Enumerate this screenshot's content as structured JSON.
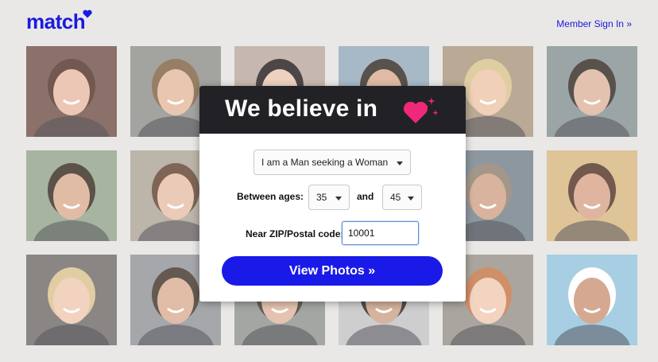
{
  "header": {
    "logo_text": "match",
    "sign_in_link": "Member Sign In »"
  },
  "photos": [
    {
      "name": "photo-1",
      "bg": "#6b4a3f",
      "skin": "#e7b8a0",
      "hair": "#4a2a1f"
    },
    {
      "name": "photo-2",
      "bg": "#8a8a86",
      "skin": "#e3b69a",
      "hair": "#7a5a3a"
    },
    {
      "name": "photo-3",
      "bg": "#b7a49a",
      "skin": "#e9c4ae",
      "hair": "#1a1412"
    },
    {
      "name": "photo-4",
      "bg": "#8fa6b6",
      "skin": "#d7a88d",
      "hair": "#2b2119"
    },
    {
      "name": "photo-5",
      "bg": "#a69178",
      "skin": "#ecc3a4",
      "hair": "#d8c089"
    },
    {
      "name": "photo-6",
      "bg": "#7f8c8c",
      "skin": "#dcb19a",
      "hair": "#2a201a"
    },
    {
      "name": "photo-7",
      "bg": "#8e9f86",
      "skin": "#d9a98c",
      "hair": "#2e2218"
    },
    {
      "name": "photo-8",
      "bg": "#aaa093",
      "skin": "#e6bda3",
      "hair": "#5a3a26"
    },
    {
      "name": "photo-9",
      "bg": "#b8a58c",
      "skin": "#e2b496",
      "hair": "#3b2b20"
    },
    {
      "name": "photo-10",
      "bg": "#a29a90",
      "skin": "#d9a78a",
      "hair": "#2a2220"
    },
    {
      "name": "photo-11",
      "bg": "#6e7a86",
      "skin": "#cf9e82",
      "hair": "#8a7a6a"
    },
    {
      "name": "photo-12",
      "bg": "#d6b47a",
      "skin": "#d8a184",
      "hair": "#4b2a1c"
    },
    {
      "name": "photo-13",
      "bg": "#6a6460",
      "skin": "#efc7ad",
      "hair": "#d9bf88"
    },
    {
      "name": "photo-14",
      "bg": "#8c8f94",
      "skin": "#d9aa8e",
      "hair": "#3a2c20"
    },
    {
      "name": "photo-15",
      "bg": "#8a8d88",
      "skin": "#deb39a",
      "hair": "#3a3028"
    },
    {
      "name": "photo-16",
      "bg": "#c0c0c2",
      "skin": "#c99e82",
      "hair": "#1e1a18"
    },
    {
      "name": "photo-17",
      "bg": "#948c84",
      "skin": "#f0c8b0",
      "hair": "#c2703e"
    },
    {
      "name": "photo-18",
      "bg": "#8fc0dc",
      "skin": "#c99172",
      "hair": "#ffffff"
    }
  ],
  "modal": {
    "headline": "We believe in",
    "seeking_select": "I am a Man seeking a Woman",
    "between_ages_label": "Between ages:",
    "age_min": "35",
    "and_label": "and",
    "age_max": "45",
    "zip_label": "Near ZIP/Postal code:",
    "zip_value": "10001",
    "view_button": "View Photos »"
  },
  "colors": {
    "brand_blue": "#1a1ae8",
    "heart_pink": "#f0287a",
    "banner_dark": "#222226"
  }
}
